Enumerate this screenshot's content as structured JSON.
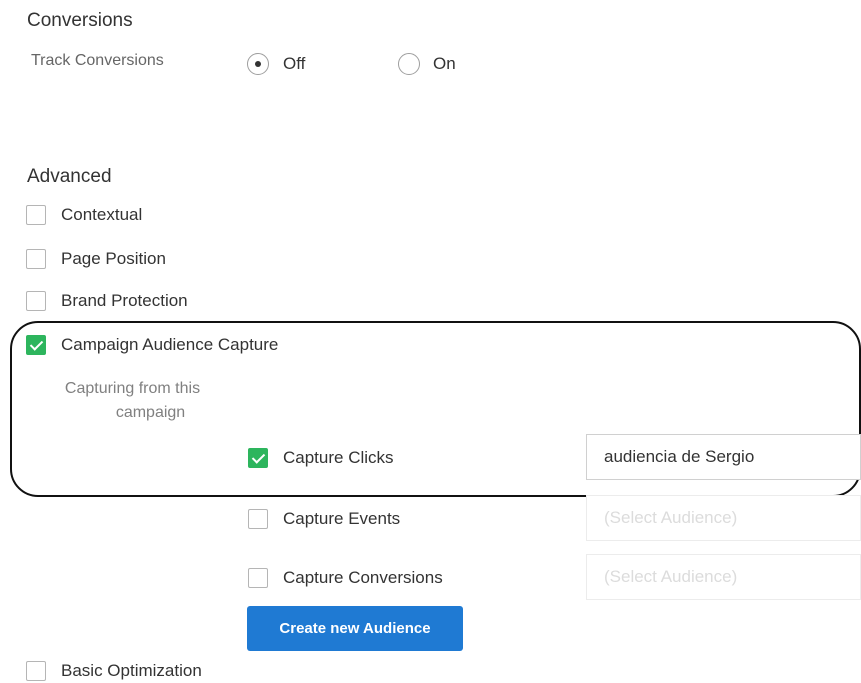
{
  "conversions": {
    "title": "Conversions",
    "track_label": "Track Conversions",
    "options": [
      {
        "label": "Off",
        "selected": true
      },
      {
        "label": "On",
        "selected": false
      }
    ]
  },
  "advanced": {
    "title": "Advanced",
    "checks": {
      "contextual": {
        "label": "Contextual",
        "checked": false
      },
      "page_position": {
        "label": "Page Position",
        "checked": false
      },
      "brand_protection": {
        "label": "Brand Protection",
        "checked": false
      },
      "campaign_audience_capture": {
        "label": "Campaign Audience Capture",
        "checked": true
      },
      "basic_optimization": {
        "label": "Basic Optimization",
        "checked": false
      }
    },
    "capture": {
      "source_label_line1": "Capturing from this",
      "source_label_line2": "campaign",
      "clicks": {
        "label": "Capture Clicks",
        "checked": true,
        "audience": "audiencia de Sergio"
      },
      "events": {
        "label": "Capture Events",
        "checked": false,
        "audience_placeholder": "(Select Audience)"
      },
      "conversions": {
        "label": "Capture Conversions",
        "checked": false,
        "audience_placeholder": "(Select Audience)"
      },
      "create_button": "Create new Audience"
    }
  },
  "colors": {
    "accent_blue": "#1f7ad3",
    "check_green": "#2db55d"
  }
}
